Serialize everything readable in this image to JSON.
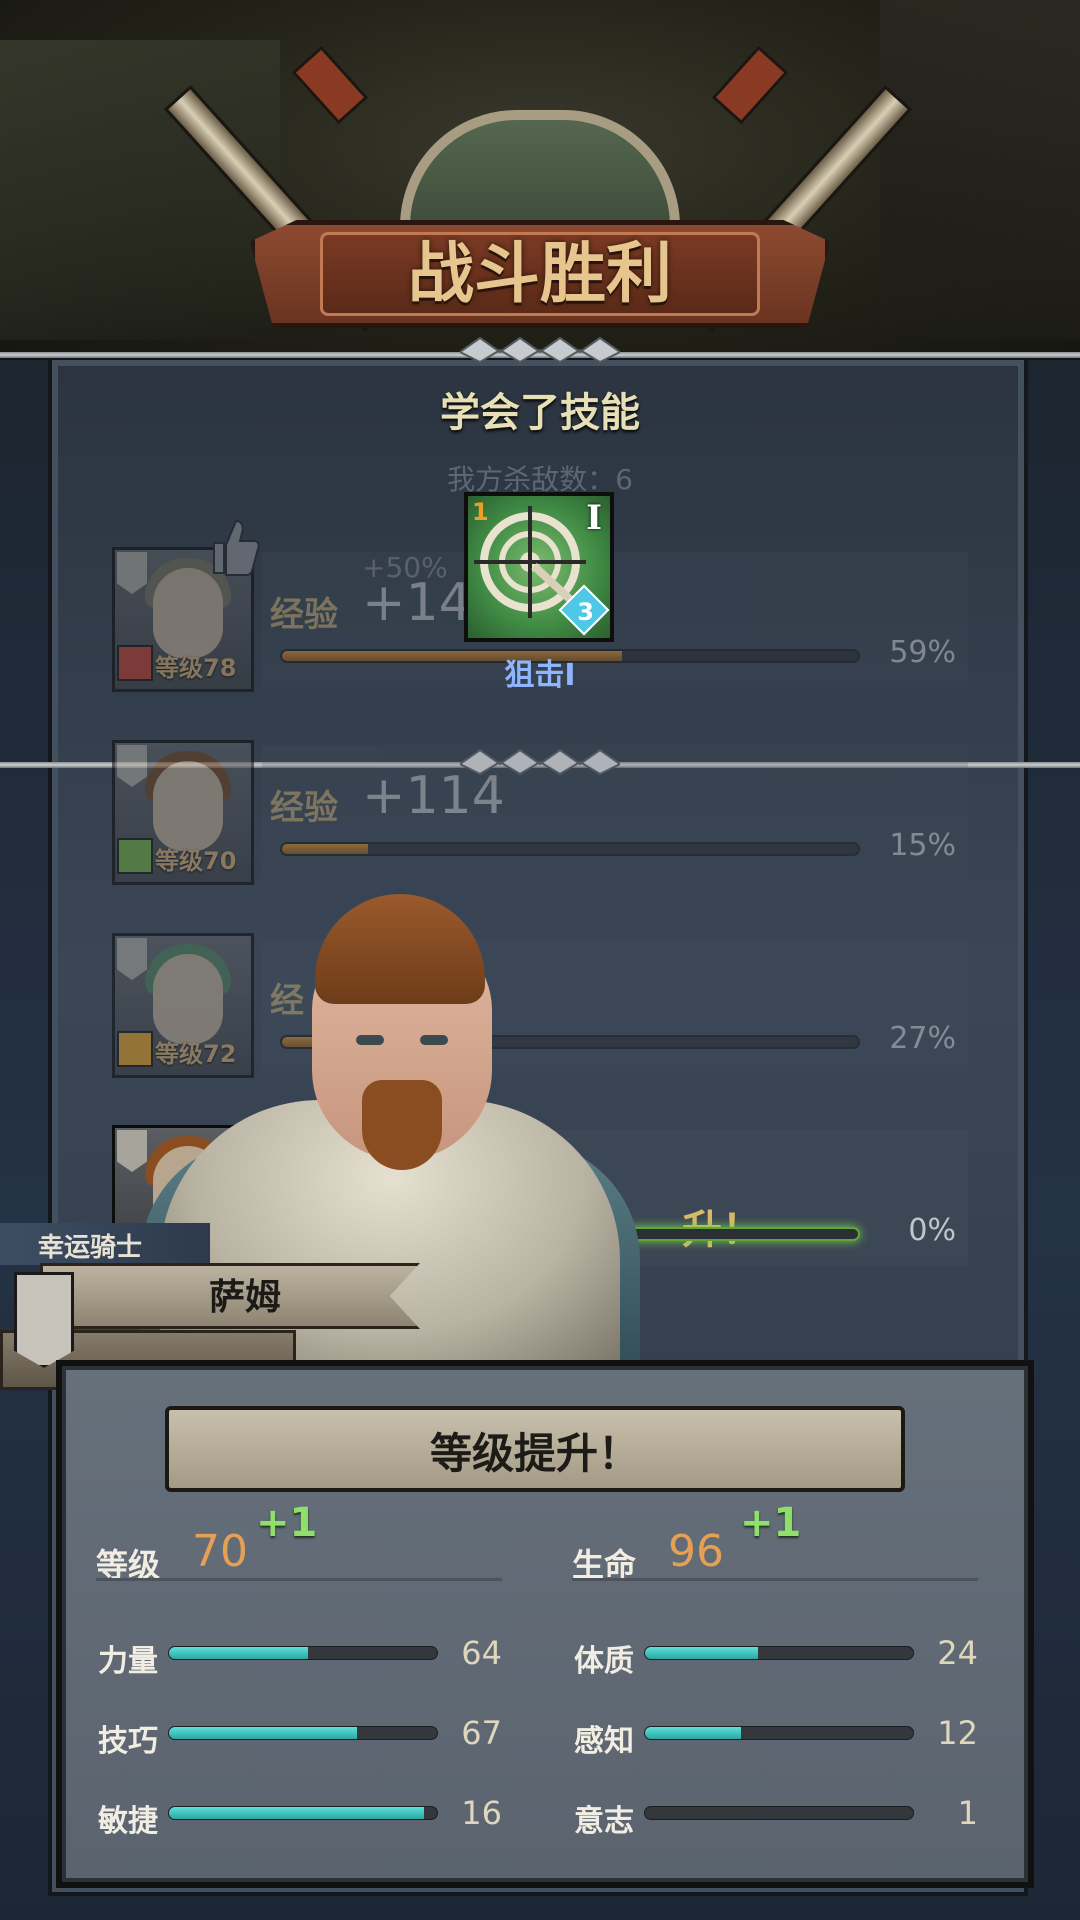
{
  "header": {
    "title": "战斗胜利",
    "subtitle": "学会了技能",
    "kill_count": "我方杀敌数：6"
  },
  "skill": {
    "name": "狙击I",
    "rank": "I",
    "level_badge": "1",
    "gem_value": "3"
  },
  "heroes": [
    {
      "level_label": "等级78",
      "exp_label": "经验",
      "exp_value": "+14",
      "bonus": "+50%",
      "progress": 0.59,
      "percent": "59%",
      "class_color": "#b93a2c",
      "hair_color": "#6e6a58"
    },
    {
      "level_label": "等级70",
      "exp_label": "经验",
      "exp_value": "+114",
      "progress": 0.15,
      "percent": "15%",
      "class_color": "#6aa83c",
      "hair_color": "#6b3f1e"
    },
    {
      "level_label": "等级72",
      "exp_label": "经",
      "progress": 0.27,
      "percent": "27%",
      "class_color": "#e09a22",
      "hair_color": "#4a7a56"
    },
    {
      "level_label": "",
      "levelup_text": "升！",
      "progress": 0.0,
      "percent": "0%",
      "class_color": "#7a7f86",
      "hair_color": "#8a4d22"
    }
  ],
  "character": {
    "class_name": "幸运骑士",
    "name": "萨姆"
  },
  "stats": {
    "banner": "等级提升！",
    "level": {
      "label": "等级",
      "value": "70",
      "plus": "+1"
    },
    "hp": {
      "label": "生命",
      "value": "96",
      "plus": "+1"
    },
    "attributes_left": [
      {
        "label": "力量",
        "value": "64",
        "fill": 0.52
      },
      {
        "label": "技巧",
        "value": "67",
        "fill": 0.7
      },
      {
        "label": "敏捷",
        "value": "16",
        "fill": 0.95
      }
    ],
    "attributes_right": [
      {
        "label": "体质",
        "value": "24",
        "fill": 0.42
      },
      {
        "label": "感知",
        "value": "12",
        "fill": 0.36
      },
      {
        "label": "意志",
        "value": "1",
        "fill": 0.0
      }
    ]
  },
  "colors": {
    "accent_title": "#e6c58e",
    "skill_name": "#8fb5ff",
    "plus_green": "#8fe06a",
    "value_orange": "#e5a054",
    "attr_bar": "#5fe0da"
  },
  "icons": [
    "crossed-swords-icon",
    "shield-emblem-icon",
    "thumbs-up-icon",
    "target-arrow-icon",
    "flag-icon"
  ]
}
